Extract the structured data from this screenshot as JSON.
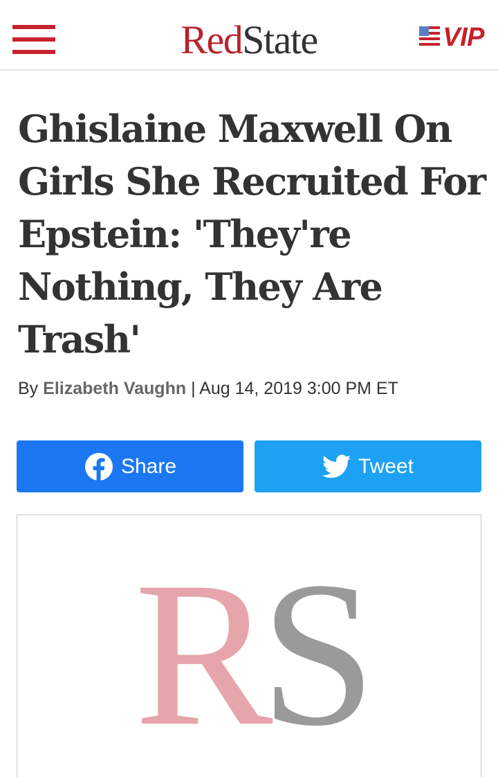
{
  "header": {
    "logo_part1": "Red",
    "logo_part2": "State",
    "vip_label": "VIP",
    "menu_icon": "hamburger-menu-icon",
    "flag_icon": "us-flag-icon"
  },
  "article": {
    "headline": "Ghislaine Maxwell On Girls She Recruited For Epstein: 'They're Nothing, They Are Trash'",
    "byline_prefix": "By",
    "author": "Elizabeth Vaughn",
    "separator": "|",
    "date": "Aug 14, 2019 3:00 PM ET"
  },
  "share": {
    "facebook_label": "Share",
    "twitter_label": "Tweet"
  },
  "image": {
    "logo_letter_r": "R",
    "logo_letter_s": "S"
  },
  "colors": {
    "brand_red": "#b8232d",
    "facebook_blue": "#1b78f2",
    "twitter_blue": "#1da1f2",
    "rs_pink": "#e5a5aa",
    "rs_gray": "#9a9a9a"
  }
}
